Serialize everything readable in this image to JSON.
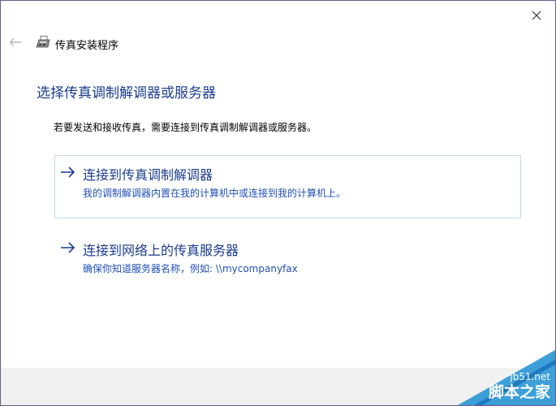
{
  "window": {
    "title": "传真安装程序"
  },
  "header": {
    "back_icon": "back-arrow-icon",
    "app_icon": "fax-machine-icon",
    "close_icon": "close-icon"
  },
  "main": {
    "heading": "选择传真调制解调器或服务器",
    "intro": "若要发送和接收传真，需要连接到传真调制解调器或服务器。",
    "options": [
      {
        "title": "连接到传真调制解调器",
        "description": "我的调制解调器内置在我的计算机中或连接到我的计算机上。",
        "selected": true
      },
      {
        "title": "连接到网络上的传真服务器",
        "description": "确保你知道服务器名称，例如: \\\\mycompanyfax",
        "selected": false
      }
    ]
  },
  "watermark": {
    "url": "jb51.net",
    "brand": "脚本之家"
  },
  "colors": {
    "accent": "#1a3c8c",
    "link": "#1f4fb8",
    "selection_border": "#c5d9ee",
    "footer": "#f0f0f0"
  }
}
